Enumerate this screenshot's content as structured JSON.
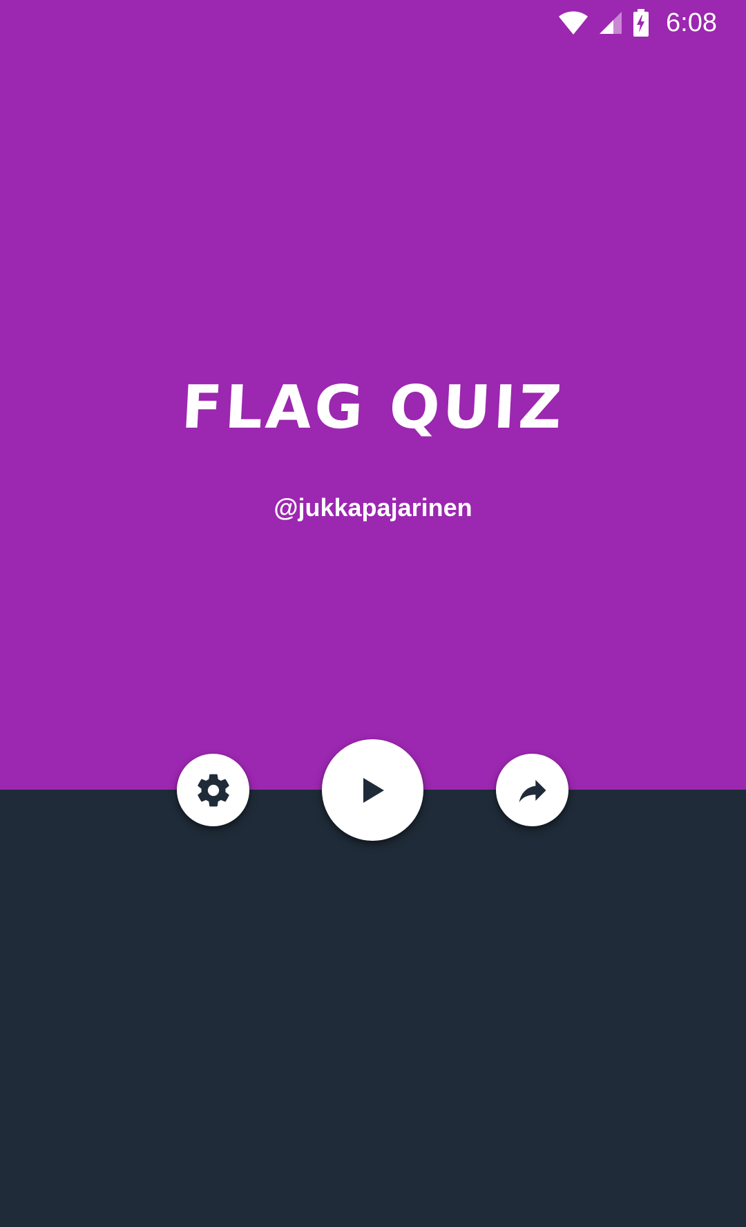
{
  "status_bar": {
    "time": "6:08",
    "icons": [
      "wifi-icon",
      "cellular-signal-icon",
      "battery-charging-icon"
    ]
  },
  "app": {
    "title": "FLAG QUIZ",
    "author": "@jukkapajarinen"
  },
  "actions": [
    {
      "name": "settings",
      "icon": "gear-icon"
    },
    {
      "name": "play",
      "icon": "play-icon"
    },
    {
      "name": "share",
      "icon": "share-icon"
    }
  ],
  "colors": {
    "top_background": "#9c27b0",
    "bottom_background": "#1f2b38",
    "button_background": "#ffffff",
    "icon_color": "#1f2b38"
  }
}
